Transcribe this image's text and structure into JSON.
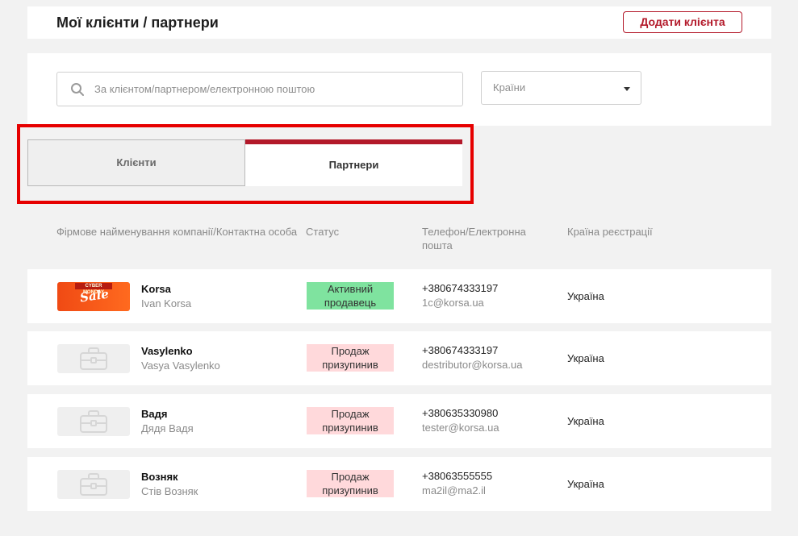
{
  "header": {
    "title": "Мої клієнти / партнери",
    "add_button": "Додати клієнта"
  },
  "filters": {
    "search_placeholder": "За клієнтом/партнером/електронною поштою",
    "country_label": "Країни"
  },
  "tabs": [
    {
      "label": "Клієнти",
      "active": false
    },
    {
      "label": "Партнери",
      "active": true
    }
  ],
  "columns": {
    "company": "Фірмове найменування компанії/Контактна особа",
    "status": "Статус",
    "phone_email_line1": "Телефон/Електронна",
    "phone_email_line2": "пошта",
    "country": "Країна реєстрації"
  },
  "rows": [
    {
      "company": "Korsa",
      "contact": "Ivan Korsa",
      "status_line1": "Активний",
      "status_line2": "продавець",
      "status_type": "active",
      "phone": "+380674333197",
      "email": "1c@korsa.ua",
      "country": "Україна",
      "logo": "sale",
      "logo_text": "Sale",
      "logo_banner": "CYBER MONDAY"
    },
    {
      "company": "Vasylenko",
      "contact": "Vasya Vasylenko",
      "status_line1": "Продаж",
      "status_line2": "призупинив",
      "status_type": "paused",
      "phone": "+380674333197",
      "email": "destributor@korsa.ua",
      "country": "Україна",
      "logo": "briefcase"
    },
    {
      "company": "Вадя",
      "contact": "Дядя Вадя",
      "status_line1": "Продаж",
      "status_line2": "призупинив",
      "status_type": "paused",
      "phone": "+380635330980",
      "email": "tester@korsa.ua",
      "country": "Україна",
      "logo": "briefcase"
    },
    {
      "company": "Возняк",
      "contact": "Стів Возняк",
      "status_line1": "Продаж",
      "status_line2": "призупинив",
      "status_type": "paused",
      "phone": "+38063555555",
      "email": "ma2il@ma2.il",
      "country": "Україна",
      "logo": "briefcase"
    }
  ],
  "colors": {
    "accent": "#b3192a",
    "active_status": "#7fe39f",
    "paused_status": "#ffd9db",
    "highlight": "#e60000"
  }
}
